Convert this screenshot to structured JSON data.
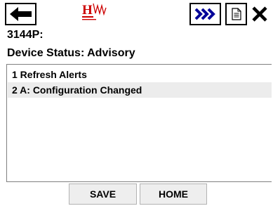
{
  "toolbar": {
    "back_icon": "left-arrow-icon",
    "logo_icon": "hart-logo-icon",
    "forward_icon": "triple-chevron-right-icon",
    "document_icon": "document-icon",
    "close_icon": "close-x-icon",
    "accent_color": "#000099",
    "logo_color": "#cc0000"
  },
  "device": {
    "tag": "3144P:"
  },
  "status": {
    "title": "Device Status: Advisory"
  },
  "menu": {
    "items": [
      {
        "label": "1 Refresh Alerts",
        "selected": false
      },
      {
        "label": "2 A: Configuration Changed",
        "selected": true
      }
    ]
  },
  "buttons": {
    "save": "SAVE",
    "home": "HOME"
  }
}
